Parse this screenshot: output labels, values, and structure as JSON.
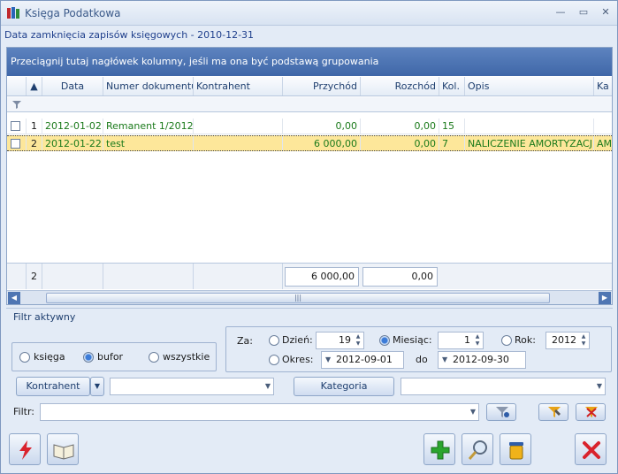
{
  "window": {
    "title": "Księga Podatkowa"
  },
  "subheader": "Data zamknięcia zapisów księgowych - 2010-12-31",
  "grid": {
    "group_hint": "Przeciągnij tutaj nagłówek kolumny, jeśli ma ona być podstawą grupowania",
    "columns": [
      "Data",
      "Numer dokumentu",
      "Kontrahent",
      "Przychód",
      "Rozchód",
      "Kol.",
      "Opis",
      "Ka"
    ],
    "rows": [
      {
        "lp": "1",
        "data": "2012-01-02",
        "numer": "Remanent 1/2012",
        "kontrahent": "",
        "przychod": "0,00",
        "rozchod": "0,00",
        "kol": "15",
        "opis": "",
        "ka": ""
      },
      {
        "lp": "2",
        "data": "2012-01-22",
        "numer": "test",
        "kontrahent": "",
        "przychod": "6 000,00",
        "rozchod": "0,00",
        "kol": "7",
        "opis": "NALICZENIE AMORTYZACJ...",
        "ka": "AM"
      }
    ],
    "footer": {
      "count": "2",
      "przychod_total": "6 000,00",
      "rozchod_total": "0,00"
    }
  },
  "filters": {
    "section_title": "Filtr aktywny",
    "radios": {
      "ksiega": "księga",
      "bufor": "bufor",
      "wszystkie": "wszystkie",
      "selected": "bufor"
    },
    "za_label": "Za:",
    "dzien_label": "Dzień:",
    "dzien_value": "19",
    "miesiac_label": "Miesiąc:",
    "miesiac_value": "1",
    "rok_label": "Rok:",
    "rok_value": "2012",
    "okres_label": "Okres:",
    "okres_from": "2012-09-01",
    "do_label": "do",
    "okres_to": "2012-09-30",
    "period_selected": "miesiac",
    "kontrahent_button": "Kontrahent",
    "kontrahent_value": "",
    "kategoria_button": "Kategoria",
    "kategoria_value": "",
    "filtr_label": "Filtr:",
    "filtr_value": ""
  },
  "colors": {
    "accent": "#3f67a8",
    "selected_row": "#fde79a",
    "text_green": "#1b7a1b"
  }
}
